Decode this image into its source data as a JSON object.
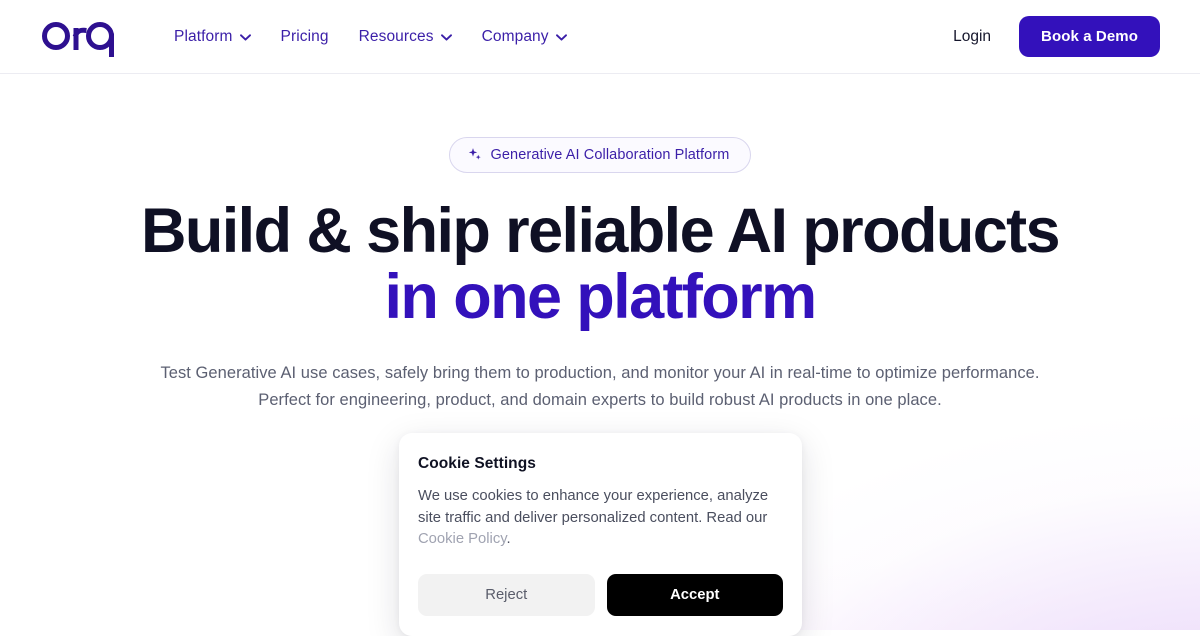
{
  "brand": {
    "logo_text": "orq",
    "logo_color": "#2e1090",
    "accent_color": "#3311bb"
  },
  "nav": {
    "items": [
      {
        "label": "Platform",
        "has_dropdown": true,
        "icon": "chevron-down-icon"
      },
      {
        "label": "Pricing",
        "has_dropdown": false,
        "icon": ""
      },
      {
        "label": "Resources",
        "has_dropdown": true,
        "icon": "chevron-down-icon"
      },
      {
        "label": "Company",
        "has_dropdown": true,
        "icon": "chevron-down-icon"
      }
    ],
    "login_label": "Login",
    "demo_label": "Book a Demo"
  },
  "hero": {
    "badge": {
      "icon": "sparkle-icon",
      "label": "Generative AI Collaboration Platform"
    },
    "headline_line1": "Build & ship reliable AI products",
    "headline_line2": "in one platform",
    "subtitle_line1": "Test Generative AI use cases, safely bring them to production, and monitor your AI in real-time to optimize performance.",
    "subtitle_line2": "Perfect for engineering, product, and domain experts to build robust AI products in one place.",
    "cta_secondary_label": "",
    "cta_primary_label": ""
  },
  "cookie_dialog": {
    "title": "Cookie Settings",
    "body_text": "We use cookies to enhance your experience, analyze site traffic and deliver personalized content. Read our ",
    "policy_link": "Cookie Policy",
    "body_suffix": ".",
    "reject_label": "Reject",
    "accept_label": "Accept"
  }
}
